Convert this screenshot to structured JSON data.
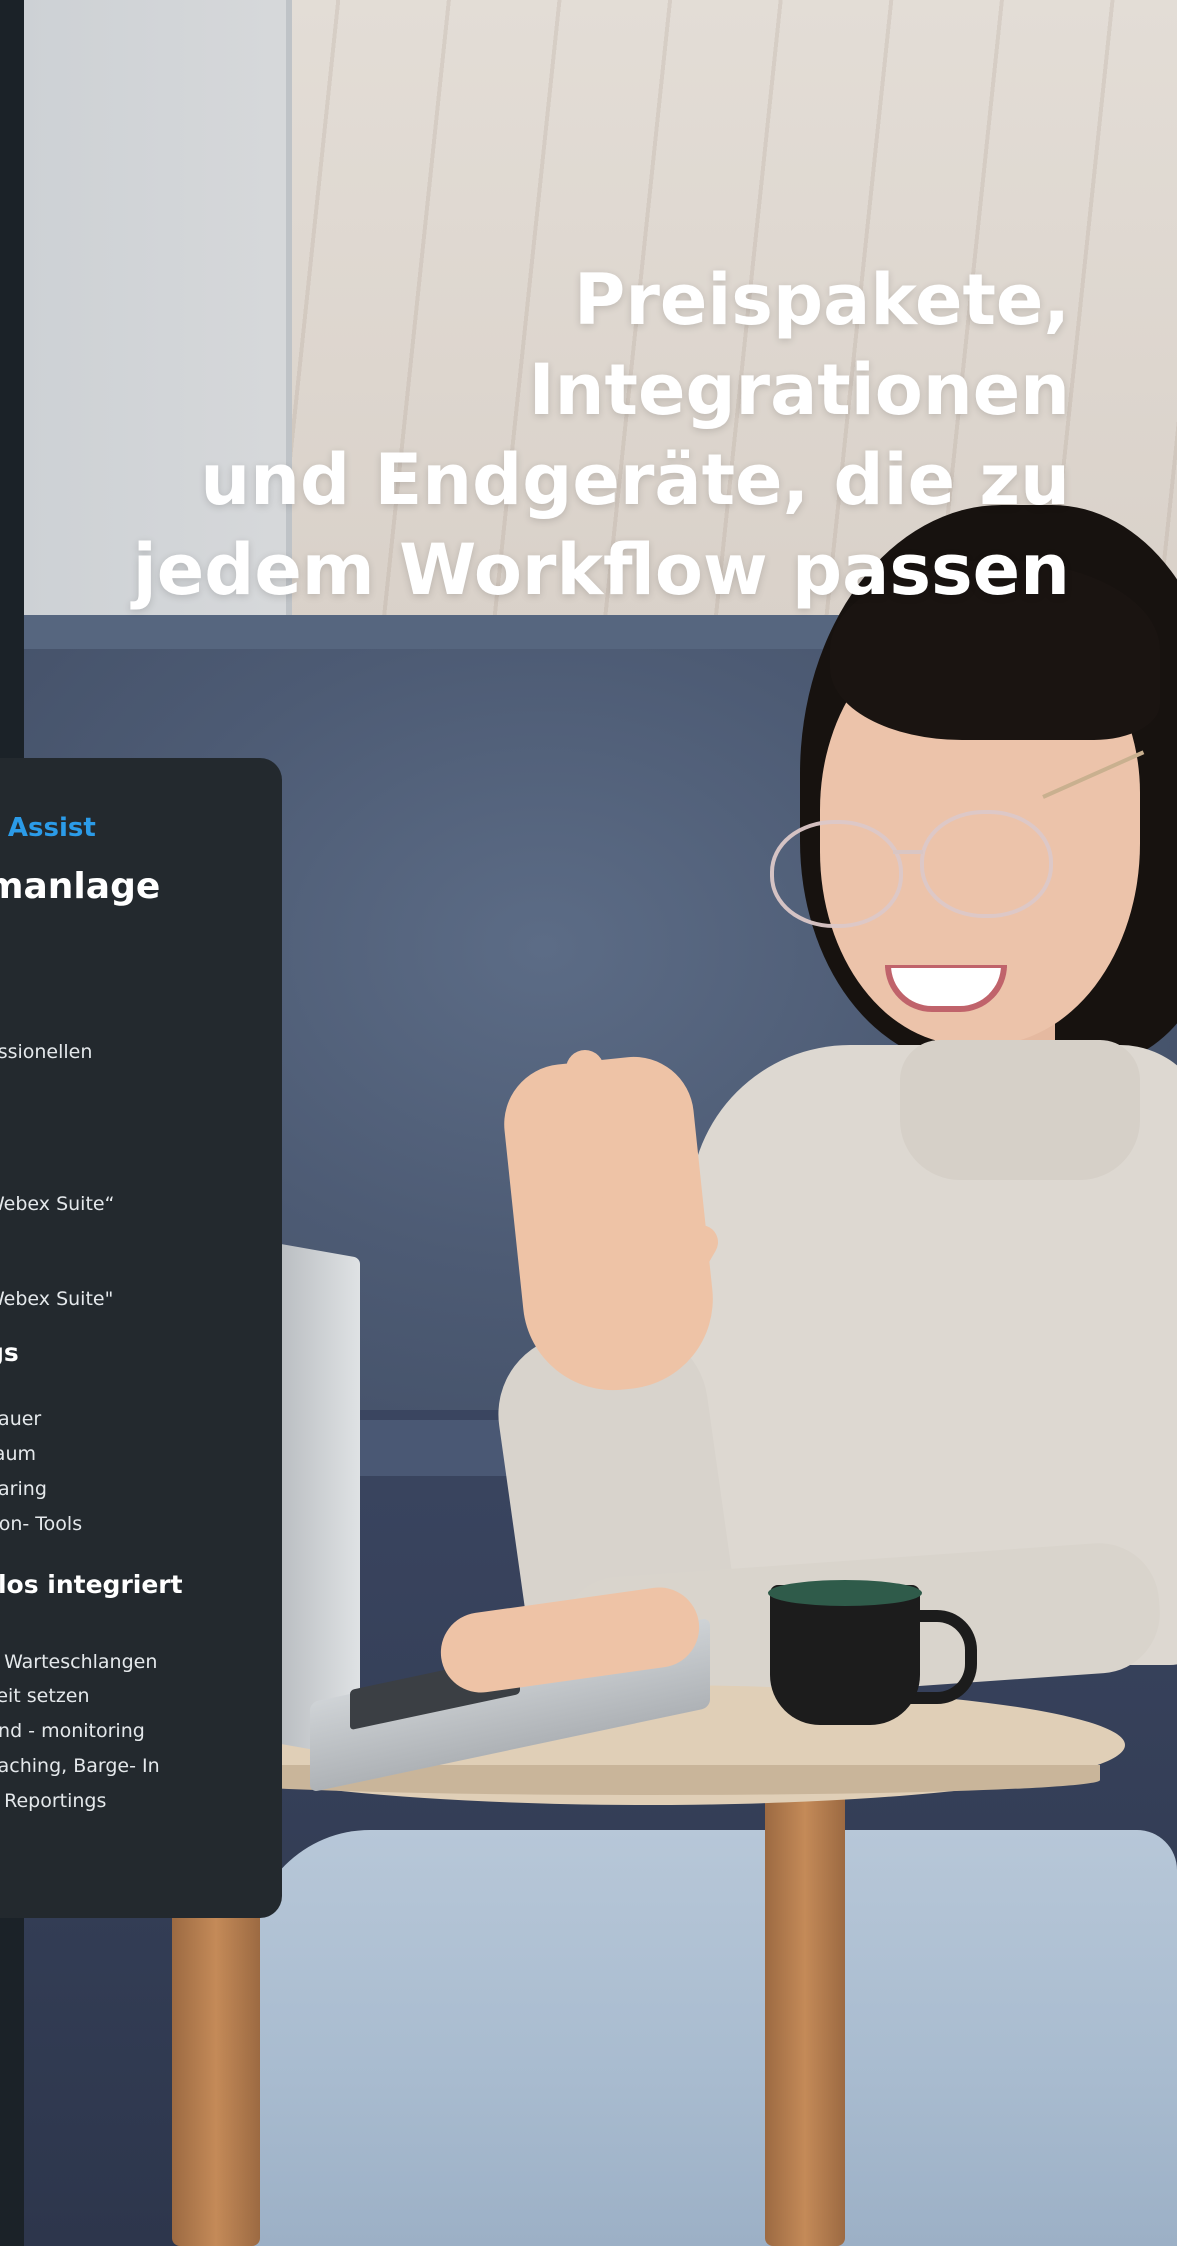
{
  "headline": {
    "line1": "Preispakete, Integrationen",
    "line2": "und Endgeräte, die zu",
    "line3": "jedem Workflow passen"
  },
  "card": {
    "kicker": "r Assist",
    "title": "manlage",
    "line_1": "essionellen",
    "line_2": "Webex Suite“",
    "line_3": "Webex Suite\"",
    "subheading_1": "gs",
    "list_1": [
      "-",
      "dauer",
      "raum",
      "haring",
      "tion- Tools"
    ],
    "subheading_2": "tlos integriert",
    "list_2": [
      "n Warteschlangen",
      "keit setzen",
      "und - monitoring",
      "oaching, Barge- In",
      "d Reportings"
    ]
  },
  "colors": {
    "accent": "#2b9be8",
    "card_background": "#23292e",
    "headline": "#ffffff"
  }
}
